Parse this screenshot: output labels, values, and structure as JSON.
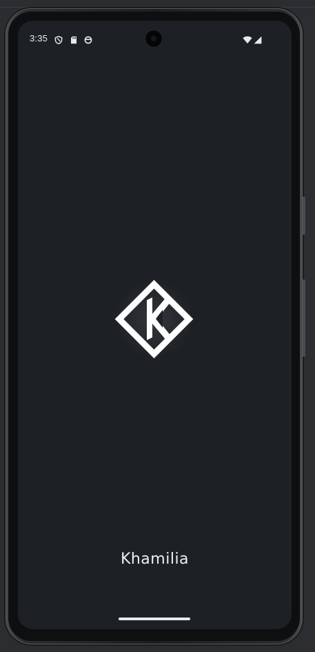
{
  "status_bar": {
    "time": "3:35",
    "left_icons": [
      "shield-icon",
      "sd-card-icon",
      "sync-icon"
    ],
    "right_icons": [
      "wifi-icon",
      "cell-signal-icon"
    ]
  },
  "splash": {
    "logo_icon": "khamilia-k-diamond-logo",
    "app_name": "Khamilia"
  },
  "colors": {
    "screen_background": "#1d2125",
    "logo": "#ffffff",
    "text": "#eef0f2"
  }
}
